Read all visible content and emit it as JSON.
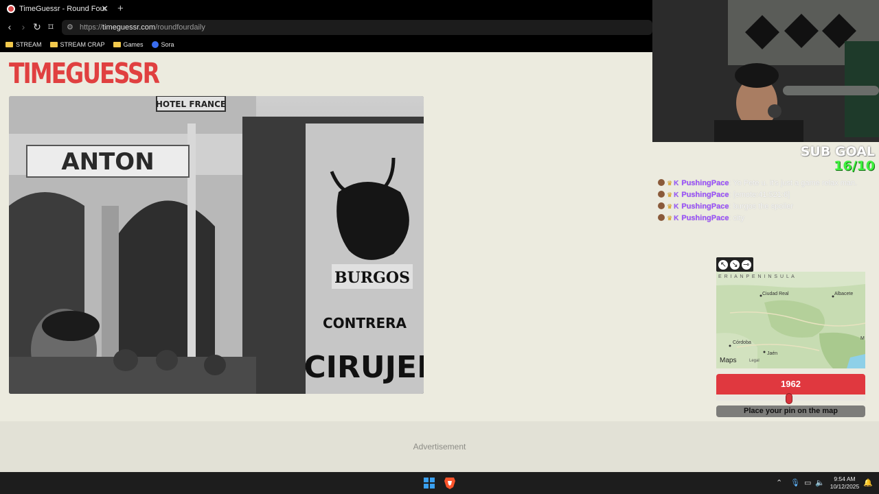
{
  "browser": {
    "tab_title": "TimeGuessr - Round Four",
    "tab_close": "✕",
    "new_tab": "+",
    "url_prefix": "https://",
    "url_host": "timeguessr.com",
    "url_path": "/roundfourdaily",
    "bookmarks": [
      {
        "label": "STREAM",
        "icon": "folder-icon"
      },
      {
        "label": "STREAM CRAP",
        "icon": "folder-icon"
      },
      {
        "label": "Games",
        "icon": "folder-icon"
      },
      {
        "label": "Sora",
        "icon": "sora-icon"
      }
    ]
  },
  "site": {
    "logo": "TIMEGUESSR",
    "advertisement": "Advertisement"
  },
  "photo": {
    "signs": [
      "HOTEL FRANCE",
      "ANTON",
      "BURGOS",
      "CONTRERA",
      "CIRUJED"
    ]
  },
  "overlay": {
    "sub_goal_label": "SUB GOAL",
    "sub_goal_value": "16/10",
    "chat": [
      {
        "user": "PushingPace",
        "msg": ": Yo Pete u. it's just a game relax man."
      },
      {
        "user": "PushingPace",
        "msg": ": [emote:41:521:6]"
      },
      {
        "user": "PushingPace",
        "msg": ": burgos the spoiler"
      },
      {
        "user": "PushingPace",
        "msg": ": city"
      }
    ]
  },
  "game": {
    "map_labels": {
      "region": "E R I A N   P E N I N S U L A",
      "ciudad_real": "Ciudad Real",
      "albacete": "Albacete",
      "cordoba": "Córdoba",
      "jaen": "Jaén",
      "m": "M",
      "maps": "Maps",
      "legal": "Legal"
    },
    "year": "1962",
    "year_slider_fraction": 0.49,
    "pin_prompt": "Place your pin on the map"
  },
  "taskbar": {
    "time": "9:54 AM",
    "date": "10/12/2025"
  }
}
